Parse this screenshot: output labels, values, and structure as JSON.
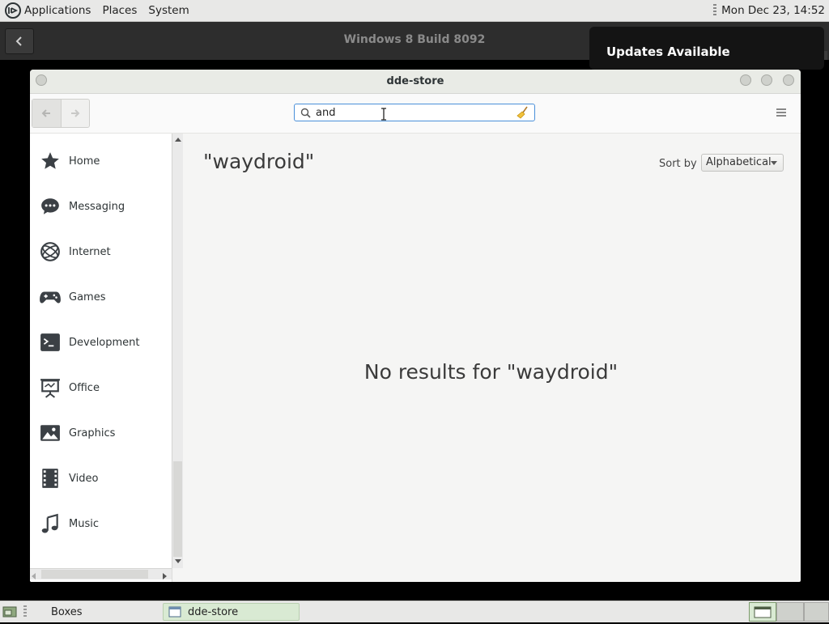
{
  "top_panel": {
    "menus": [
      "Applications",
      "Places",
      "System"
    ],
    "clock": "Mon Dec 23, 14:52"
  },
  "vm_window": {
    "title": "Windows 8 Build 8092"
  },
  "notification": {
    "text": "Updates Available"
  },
  "app_window": {
    "title": "dde-store",
    "search_value": "and",
    "categories": [
      {
        "label": "Home",
        "icon": "star-icon"
      },
      {
        "label": "Messaging",
        "icon": "chat-bubble-icon"
      },
      {
        "label": "Internet",
        "icon": "globe-icon"
      },
      {
        "label": "Games",
        "icon": "gamepad-icon"
      },
      {
        "label": "Development",
        "icon": "terminal-icon"
      },
      {
        "label": "Office",
        "icon": "presentation-icon"
      },
      {
        "label": "Graphics",
        "icon": "image-icon"
      },
      {
        "label": "Video",
        "icon": "film-icon"
      },
      {
        "label": "Music",
        "icon": "music-note-icon"
      }
    ],
    "results_title": "\"waydroid\"",
    "sort_label": "Sort by",
    "sort_value": "Alphabetical",
    "empty_message": "No results for \"waydroid\""
  },
  "bottom_panel": {
    "tasks": [
      "Boxes",
      "dde-store"
    ]
  }
}
